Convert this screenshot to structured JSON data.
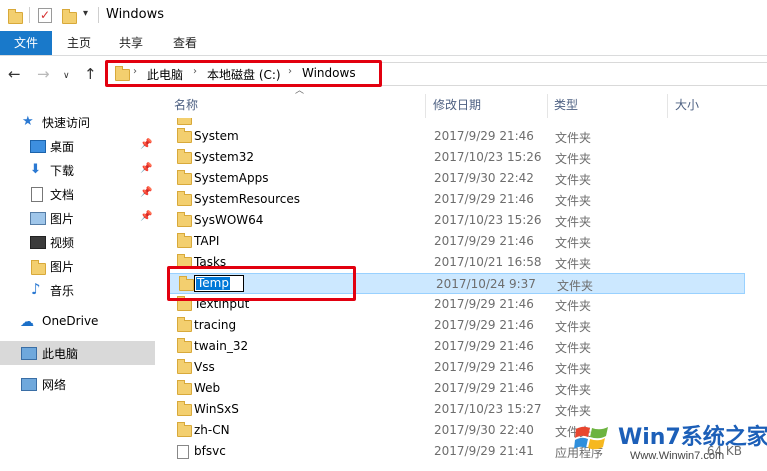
{
  "window": {
    "title": "Windows"
  },
  "ribbon": {
    "tabs": [
      "文件",
      "主页",
      "共享",
      "查看"
    ]
  },
  "address": {
    "breadcrumbs": [
      "此电脑",
      "本地磁盘 (C:)",
      "Windows"
    ]
  },
  "nav_pane": {
    "quick_access": "快速访问",
    "items": [
      {
        "label": "桌面",
        "icon": "desktop-icon",
        "pinned": true
      },
      {
        "label": "下载",
        "icon": "download-icon",
        "pinned": true
      },
      {
        "label": "文档",
        "icon": "document-icon",
        "pinned": true
      },
      {
        "label": "图片",
        "icon": "pictures-icon",
        "pinned": true
      },
      {
        "label": "视频",
        "icon": "video-icon",
        "pinned": false
      },
      {
        "label": "图片",
        "icon": "folder-icon",
        "pinned": false
      },
      {
        "label": "音乐",
        "icon": "music-icon",
        "pinned": false
      }
    ],
    "onedrive": "OneDrive",
    "this_pc": "此电脑",
    "network": "网络"
  },
  "columns": {
    "name": "名称",
    "date": "修改日期",
    "type": "类型",
    "size": "大小"
  },
  "files": [
    {
      "name": "System",
      "date": "2017/9/29 21:46",
      "type": "文件夹",
      "size": ""
    },
    {
      "name": "System32",
      "date": "2017/10/23 15:26",
      "type": "文件夹",
      "size": ""
    },
    {
      "name": "SystemApps",
      "date": "2017/9/30 22:42",
      "type": "文件夹",
      "size": ""
    },
    {
      "name": "SystemResources",
      "date": "2017/9/29 21:46",
      "type": "文件夹",
      "size": ""
    },
    {
      "name": "SysWOW64",
      "date": "2017/10/23 15:26",
      "type": "文件夹",
      "size": ""
    },
    {
      "name": "TAPI",
      "date": "2017/9/29 21:46",
      "type": "文件夹",
      "size": ""
    },
    {
      "name": "Tasks",
      "date": "2017/10/21 16:58",
      "type": "文件夹",
      "size": ""
    },
    {
      "name": "Temp",
      "date": "2017/10/24 9:37",
      "type": "文件夹",
      "size": "",
      "selected": true,
      "renaming": true
    },
    {
      "name": "TextInput",
      "date": "2017/9/29 21:46",
      "type": "文件夹",
      "size": ""
    },
    {
      "name": "tracing",
      "date": "2017/9/29 21:46",
      "type": "文件夹",
      "size": ""
    },
    {
      "name": "twain_32",
      "date": "2017/9/29 21:46",
      "type": "文件夹",
      "size": ""
    },
    {
      "name": "Vss",
      "date": "2017/9/29 21:46",
      "type": "文件夹",
      "size": ""
    },
    {
      "name": "Web",
      "date": "2017/9/29 21:46",
      "type": "文件夹",
      "size": ""
    },
    {
      "name": "WinSxS",
      "date": "2017/10/23 15:27",
      "type": "文件夹",
      "size": ""
    },
    {
      "name": "zh-CN",
      "date": "2017/9/30 22:40",
      "type": "文件夹",
      "size": ""
    },
    {
      "name": "bfsvc",
      "date": "2017/9/29 21:41",
      "type": "应用程序",
      "size": "64 KB",
      "kind": "file"
    }
  ],
  "watermark": {
    "brand": "Win7系统之家",
    "url": "Www.Winwin7.com"
  },
  "colors": {
    "accent": "#1979ca",
    "selection": "#cce8ff",
    "highlight_frame": "#e2000f",
    "folder": "#f3cf6f"
  }
}
